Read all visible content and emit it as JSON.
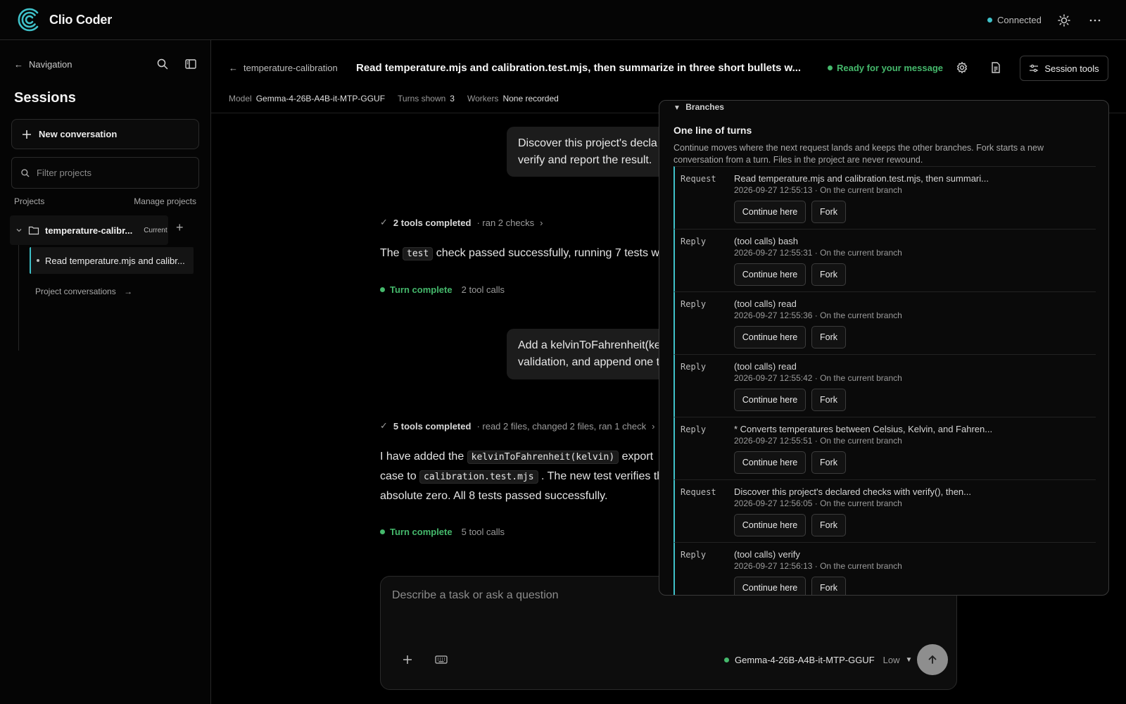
{
  "app": {
    "title": "Clio Coder",
    "connection_status": "Connected",
    "accent": "#3fc1c9"
  },
  "sidebar": {
    "nav_label": "Navigation",
    "sessions_title": "Sessions",
    "new_conversation": "New conversation",
    "filter_placeholder": "Filter projects",
    "projects_label": "Projects",
    "manage_projects": "Manage projects",
    "project": {
      "name": "temperature-calibr...",
      "badge": "Current"
    },
    "session_item": "Read temperature.mjs and calibr...",
    "project_conversations": "Project conversations"
  },
  "header": {
    "breadcrumb": "temperature-calibration",
    "title": "Read temperature.mjs and calibration.test.mjs, then summarize in three short bullets w...",
    "status": "Ready for your message",
    "status_color": "#45b96c",
    "session_tools": "Session tools",
    "meta": {
      "model_label": "Model",
      "model_value": "Gemma-4-26B-A4B-it-MTP-GGUF",
      "turns_label": "Turns shown",
      "turns_value": "3",
      "workers_label": "Workers",
      "workers_value": "None recorded"
    }
  },
  "chat": {
    "user_msg_1": {
      "line1": "Discover this project's decla",
      "line2": "verify and report the result."
    },
    "tools_1": {
      "summary": "2 tools completed",
      "detail": "· ran 2 checks"
    },
    "reply_1": {
      "pre": "The",
      "code": "test",
      "post": "check passed successfully, running 7 tests w"
    },
    "turn_1": {
      "status": "Turn complete",
      "calls": "2 tool calls"
    },
    "user_msg_2": {
      "line1": "Add a kelvinToFahrenheit(ke",
      "line2": "validation, and append one t"
    },
    "tools_2": {
      "summary": "5 tools completed",
      "detail": "· read 2 files, changed 2 files, ran 1 check"
    },
    "reply_2": {
      "l1_pre": "I have added the",
      "l1_code": "kelvinToFahrenheit(kelvin)",
      "l1_post": "export",
      "l2_pre": "case to",
      "l2_code": "calibration.test.mjs",
      "l2_post": ". The new test verifies th",
      "l3": "absolute zero. All 8 tests passed successfully."
    },
    "turn_2": {
      "status": "Turn complete",
      "calls": "5 tool calls"
    }
  },
  "composer": {
    "placeholder": "Describe a task or ask a question",
    "model": "Gemma-4-26B-A4B-it-MTP-GGUF",
    "effort": "Low"
  },
  "branches": {
    "summary": "Branches",
    "heading": "One line of turns",
    "description": "Continue moves where the next request lands and keeps the other branches. Fork starts a new conversation from a turn. Files in the project are never rewound.",
    "continue_label": "Continue here",
    "fork_label": "Fork",
    "turns": [
      {
        "role": "Request",
        "summary": "Read temperature.mjs and calibration.test.mjs, then summari...",
        "meta": "2026-09-27 12:55:13 · On the current branch"
      },
      {
        "role": "Reply",
        "summary": "(tool calls) bash",
        "meta": "2026-09-27 12:55:31 · On the current branch"
      },
      {
        "role": "Reply",
        "summary": "(tool calls) read",
        "meta": "2026-09-27 12:55:36 · On the current branch"
      },
      {
        "role": "Reply",
        "summary": "(tool calls) read",
        "meta": "2026-09-27 12:55:42 · On the current branch"
      },
      {
        "role": "Reply",
        "summary": "* Converts temperatures between Celsius, Kelvin, and Fahren...",
        "meta": "2026-09-27 12:55:51 · On the current branch"
      },
      {
        "role": "Request",
        "summary": "Discover this project's declared checks with verify(), then...",
        "meta": "2026-09-27 12:56:05 · On the current branch"
      },
      {
        "role": "Reply",
        "summary": "(tool calls) verify",
        "meta": "2026-09-27 12:56:13 · On the current branch"
      }
    ]
  }
}
